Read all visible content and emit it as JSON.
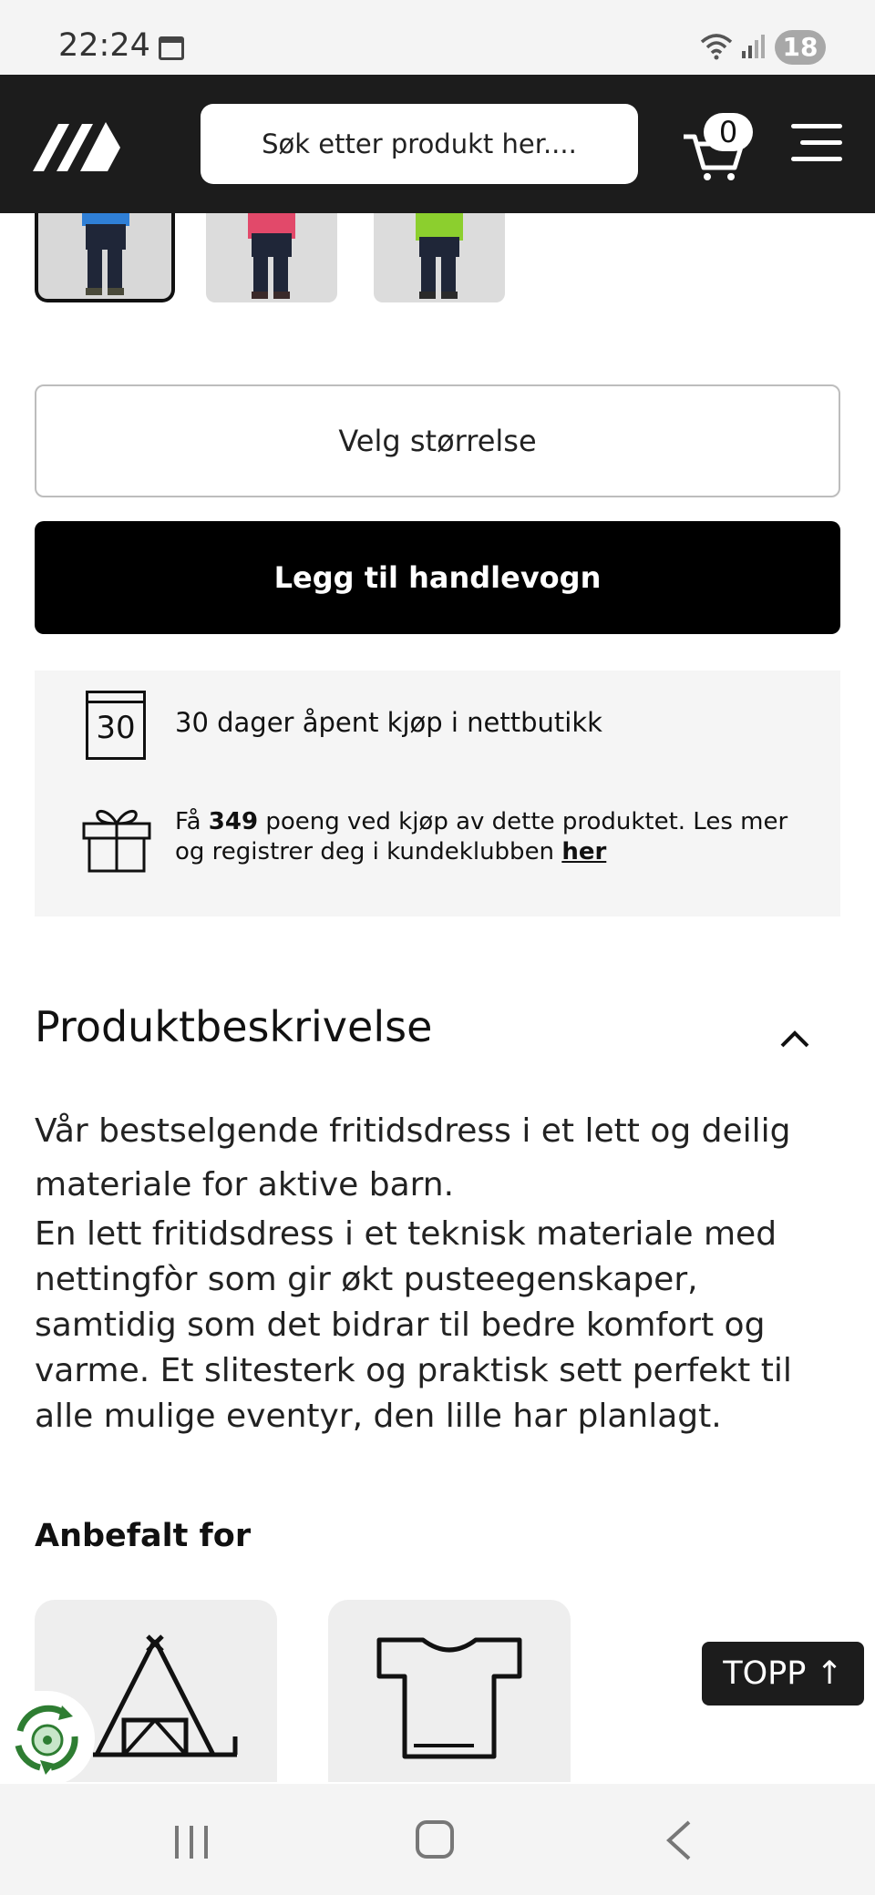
{
  "status_bar": {
    "time": "22:24",
    "battery": "18"
  },
  "header": {
    "search_placeholder": "Søk etter produkt her....",
    "cart_count": "0"
  },
  "product": {
    "size_select_label": "Velg størrelse",
    "add_to_cart_label": "Legg til handlevogn"
  },
  "info": {
    "return_days": "30",
    "return_text": "30 dager åpent kjøp i nettbutikk",
    "points_prefix": "Få",
    "points_value": "349",
    "points_suffix": "poeng ved kjøp av dette produktet. Les mer og registrer deg i kundeklubben",
    "points_link": "her"
  },
  "description": {
    "title": "Produktbeskrivelse",
    "lead": "Vår bestselgende fritidsdress i et lett og deilig materiale for aktive barn.",
    "body": "En lett fritidsdress i et teknisk materiale med nettingfòr som gir økt pusteegenskaper, samtidig som det bidrar til bedre komfort og varme. Et slitesterk og praktisk sett perfekt til alle mulige eventyr, den lille har planlagt."
  },
  "recommended": {
    "title": "Anbefalt for"
  },
  "scroll_top_label": "TOPP ↑",
  "colors": {
    "header_bg": "#1c1c1c",
    "button_bg": "#000000",
    "eco_green": "#2e7d32"
  },
  "icons": [
    "calendar-icon",
    "wifi-icon",
    "signal-icon",
    "logo-icon",
    "cart-icon",
    "menu-icon",
    "calendar-30-icon",
    "gift-icon",
    "chevron-up-icon",
    "tent-icon",
    "tshirt-icon",
    "eco-recycle-icon"
  ]
}
